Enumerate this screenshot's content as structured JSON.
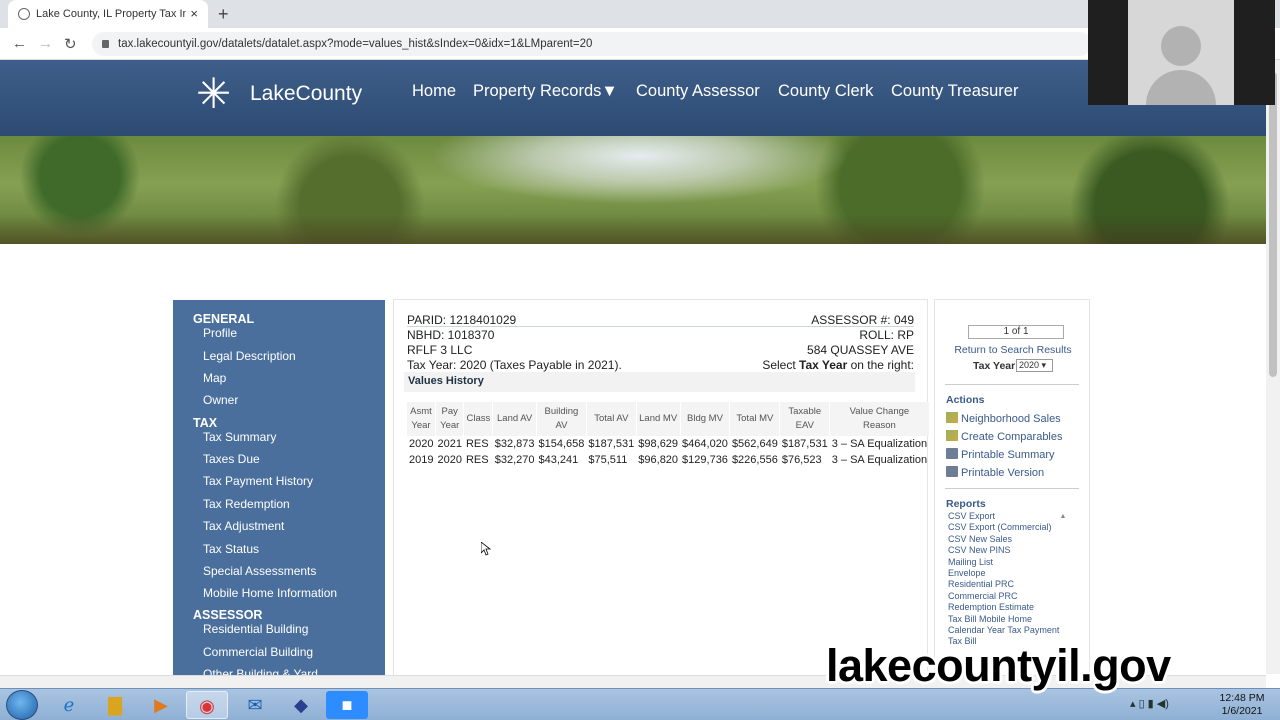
{
  "browser": {
    "tab_title": "Lake County, IL Property Tax Info",
    "tab_close": "×",
    "new_tab": "+",
    "url": "tax.lakecountyil.gov/datalets/datalet.aspx?mode=values_hist&sIndex=0&idx=1&LMparent=20",
    "back_icon": "←",
    "forward_icon": "→",
    "reload_icon": "↻"
  },
  "site": {
    "logo_text": "LakeCounty",
    "logo_glyph": "✳",
    "nav": [
      "Home",
      "Property Records▼",
      "County Assessor",
      "County Clerk",
      "County Treasurer"
    ]
  },
  "sidebar": {
    "general_heading": "GENERAL",
    "general_items": [
      "Profile",
      "Legal Description",
      "Map",
      "Owner"
    ],
    "tax_heading": "TAX",
    "tax_items": [
      "Tax Summary",
      "Taxes Due",
      "Tax Payment History",
      "Tax Redemption",
      "Tax Adjustment",
      "Tax Status",
      "Special Assessments",
      "Mobile Home Information"
    ],
    "assessor_heading": "ASSESSOR",
    "assessor_items": [
      "Residential Building",
      "Commercial Building",
      "Other Building & Yard"
    ]
  },
  "parcel": {
    "parid": "PARID: 1218401029",
    "assessor": "ASSESSOR #: 049",
    "nbhd": "NBHD: 1018370",
    "roll": "ROLL: RP",
    "owner": "RFLF 3 LLC",
    "address": "584 QUASSEY AVE",
    "tax_year": "Tax Year: 2020 (Taxes Payable in 2021).",
    "select_prefix": "Select ",
    "select_bold": "Tax Year",
    "select_suffix": " on the right:"
  },
  "values_history": {
    "title": "Values History",
    "headers": [
      "Asmt Year",
      "Pay Year",
      "Class",
      "Land AV",
      "Building AV",
      "Total AV",
      "Land MV",
      "Bldg MV",
      "Total MV",
      "Taxable EAV",
      "Value Change Reason"
    ],
    "rows": [
      [
        "2020",
        "2021",
        "RES",
        "$32,873",
        "$154,658",
        "$187,531",
        "$98,629",
        "$464,020",
        "$562,649",
        "$187,531",
        "3 – SA Equalization"
      ],
      [
        "2019",
        "2020",
        "RES",
        "$32,270",
        "$43,241",
        "$75,511",
        "$96,820",
        "$129,736",
        "$226,556",
        "$76,523",
        "3 – SA Equalization"
      ]
    ]
  },
  "right_panel": {
    "pager": "1 of 1",
    "return_link": "Return to Search Results",
    "tax_year_label": "Tax Year",
    "tax_year_value": "2020",
    "actions_heading": "Actions",
    "actions": [
      "Neighborhood Sales",
      "Create Comparables",
      "Printable Summary",
      "Printable Version"
    ],
    "reports_heading": "Reports",
    "reports": [
      "CSV Export",
      "CSV Export (Commercial)",
      "CSV New Sales",
      "CSV New PINS",
      "Mailing List",
      "Envelope",
      "Residential PRC",
      "Commercial PRC",
      "Redemption Estimate",
      "Tax Bill Mobile Home",
      "Calendar Year Tax Payment",
      "Tax Bill"
    ]
  },
  "overlay": {
    "watermark": "lakecountyil.gov"
  },
  "taskbar": {
    "time": "12:48 PM",
    "date": "1/6/2021"
  }
}
